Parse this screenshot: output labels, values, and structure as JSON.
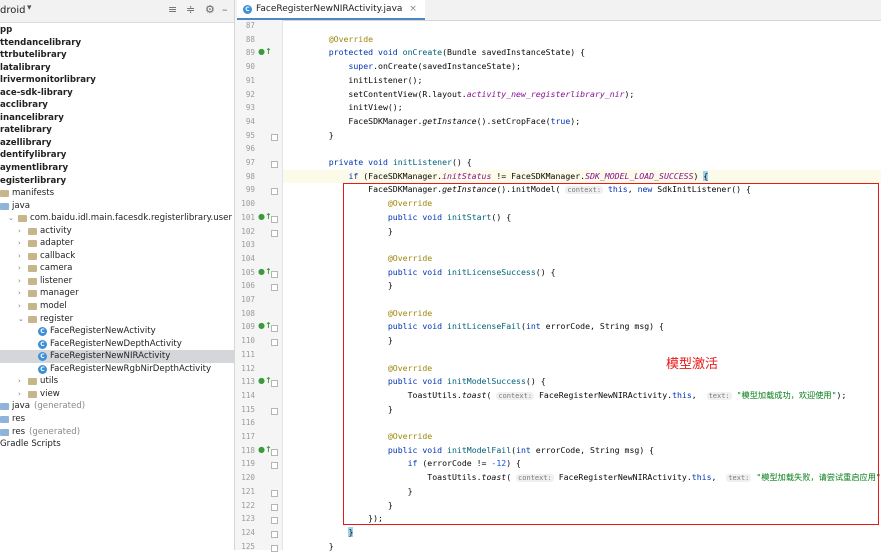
{
  "project_panel": {
    "title": "droid",
    "tree": [
      {
        "label": "pp",
        "bold": true,
        "indent": 0,
        "icon": "none"
      },
      {
        "label": "ttendancelibrary",
        "bold": true,
        "indent": 0,
        "icon": "none"
      },
      {
        "label": "ttrbutelibrary",
        "bold": true,
        "indent": 0,
        "icon": "none"
      },
      {
        "label": "latalibrary",
        "bold": true,
        "indent": 0,
        "icon": "none"
      },
      {
        "label": "lrivermonitorlibrary",
        "bold": true,
        "indent": 0,
        "icon": "none"
      },
      {
        "label": "ace-sdk-library",
        "bold": true,
        "indent": 0,
        "icon": "none"
      },
      {
        "label": "acclibrary",
        "bold": true,
        "indent": 0,
        "icon": "none"
      },
      {
        "label": "inancelibrary",
        "bold": true,
        "indent": 0,
        "icon": "none"
      },
      {
        "label": "ratelibrary",
        "bold": true,
        "indent": 0,
        "icon": "none"
      },
      {
        "label": "azellibrary",
        "bold": true,
        "indent": 0,
        "icon": "none"
      },
      {
        "label": "dentifylibrary",
        "bold": true,
        "indent": 0,
        "icon": "none"
      },
      {
        "label": "aymentlibrary",
        "bold": true,
        "indent": 0,
        "icon": "none"
      },
      {
        "label": "egisterlibrary",
        "bold": true,
        "indent": 0,
        "icon": "none"
      },
      {
        "label": "manifests",
        "bold": false,
        "indent": 0,
        "icon": "folder"
      },
      {
        "label": "java",
        "bold": false,
        "indent": 0,
        "icon": "folder"
      },
      {
        "label": "com.baidu.idl.main.facesdk.registerlibrary.user",
        "bold": false,
        "indent": 1,
        "icon": "folder",
        "arrow": "open"
      },
      {
        "label": "activity",
        "bold": false,
        "indent": 2,
        "icon": "folder",
        "arrow": "closed"
      },
      {
        "label": "adapter",
        "bold": false,
        "indent": 2,
        "icon": "folder",
        "arrow": "closed"
      },
      {
        "label": "callback",
        "bold": false,
        "indent": 2,
        "icon": "folder",
        "arrow": "closed"
      },
      {
        "label": "camera",
        "bold": false,
        "indent": 2,
        "icon": "folder",
        "arrow": "closed"
      },
      {
        "label": "listener",
        "bold": false,
        "indent": 2,
        "icon": "folder",
        "arrow": "closed"
      },
      {
        "label": "manager",
        "bold": false,
        "indent": 2,
        "icon": "folder",
        "arrow": "closed"
      },
      {
        "label": "model",
        "bold": false,
        "indent": 2,
        "icon": "folder",
        "arrow": "closed"
      },
      {
        "label": "register",
        "bold": false,
        "indent": 2,
        "icon": "folder",
        "arrow": "open"
      },
      {
        "label": "FaceRegisterNewActivity",
        "bold": false,
        "indent": 3,
        "icon": "class"
      },
      {
        "label": "FaceRegisterNewDepthActivity",
        "bold": false,
        "indent": 3,
        "icon": "class"
      },
      {
        "label": "FaceRegisterNewNIRActivity",
        "bold": false,
        "indent": 3,
        "icon": "class",
        "selected": true
      },
      {
        "label": "FaceRegisterNewRgbNirDepthActivity",
        "bold": false,
        "indent": 3,
        "icon": "class"
      },
      {
        "label": "utils",
        "bold": false,
        "indent": 2,
        "icon": "folder",
        "arrow": "closed"
      },
      {
        "label": "view",
        "bold": false,
        "indent": 2,
        "icon": "folder",
        "arrow": "closed"
      },
      {
        "label": "java",
        "bold": false,
        "indent": 0,
        "icon": "folder",
        "suffix": "(generated)"
      },
      {
        "label": "res",
        "bold": false,
        "indent": 0,
        "icon": "folder"
      },
      {
        "label": "res",
        "bold": false,
        "indent": 0,
        "icon": "folder",
        "suffix": "(generated)"
      },
      {
        "label": "Gradle Scripts",
        "bold": false,
        "indent": 0,
        "icon": "none"
      }
    ]
  },
  "editor": {
    "tab_label": "FaceRegisterNewNIRActivity.java",
    "annotation_note": "模型激活",
    "lines": [
      {
        "n": "87",
        "html": ""
      },
      {
        "n": "88",
        "html": "<span class='an'>    @Override</span>"
      },
      {
        "n": "89",
        "mark": "●↑",
        "html": "    <span class='kw'>protected void</span> <span class='fn'>onCreate</span>(Bundle savedInstanceState) {"
      },
      {
        "n": "90",
        "html": "        <span class='kw'>super</span>.onCreate(savedInstanceState);"
      },
      {
        "n": "91",
        "html": "        initListener();"
      },
      {
        "n": "92",
        "html": "        setContentView(R.layout.<span class='fd'>activity_new_registerlibrary_nir</span>);"
      },
      {
        "n": "93",
        "html": "        initView();"
      },
      {
        "n": "94",
        "html": "        FaceSDKManager.<span class='it'>getInstance</span>().setCropFace(<span class='kw'>true</span>);"
      },
      {
        "n": "95",
        "fold": true,
        "html": "    }"
      },
      {
        "n": "96",
        "html": ""
      },
      {
        "n": "97",
        "fold": true,
        "html": "    <span class='kw'>private void</span> <span class='fn'>initListener</span>() {"
      },
      {
        "n": "98",
        "hl": true,
        "html": "        <span class='kw'>if</span> (FaceSDKManager.<span class='fd'>initStatus</span> != FaceSDKManager.<span class='fd'>SDK_MODEL_LOAD_SUCCESS</span>) <span class='brm'>{</span>"
      },
      {
        "n": "99",
        "fold": true,
        "html": "            FaceSDKManager.<span class='it'>getInstance</span>().initModel( <span class='hint'>context:</span> <span class='kw'>this</span>, <span class='kw'>new</span> SdkInitListener() {"
      },
      {
        "n": "100",
        "html": "                <span class='an'>@Override</span>"
      },
      {
        "n": "101",
        "mark": "●↑",
        "fold": true,
        "html": "                <span class='kw'>public void</span> <span class='fn'>initStart</span>() {"
      },
      {
        "n": "102",
        "fold": true,
        "html": "                }"
      },
      {
        "n": "103",
        "html": ""
      },
      {
        "n": "104",
        "html": "                <span class='an'>@Override</span>"
      },
      {
        "n": "105",
        "mark": "●↑",
        "fold": true,
        "html": "                <span class='kw'>public void</span> <span class='fn'>initLicenseSuccess</span>() {"
      },
      {
        "n": "106",
        "fold": true,
        "html": "                }"
      },
      {
        "n": "107",
        "html": ""
      },
      {
        "n": "108",
        "html": "                <span class='an'>@Override</span>"
      },
      {
        "n": "109",
        "mark": "●↑",
        "fold": true,
        "html": "                <span class='kw'>public void</span> <span class='fn'>initLicenseFail</span>(<span class='kw'>int</span> errorCode, String msg) {"
      },
      {
        "n": "110",
        "fold": true,
        "html": "                }"
      },
      {
        "n": "111",
        "html": ""
      },
      {
        "n": "112",
        "html": "                <span class='an'>@Override</span>"
      },
      {
        "n": "113",
        "mark": "●↑",
        "fold": true,
        "html": "                <span class='kw'>public void</span> <span class='fn'>initModelSuccess</span>() {"
      },
      {
        "n": "114",
        "html": "                    ToastUtils.<span class='it'>toast</span>( <span class='hint'>context:</span> FaceRegisterNewNIRActivity.<span class='kw'>this</span>,  <span class='hint'>text:</span> <span class='st'>\"模型加载成功，欢迎使用\"</span>);"
      },
      {
        "n": "115",
        "fold": true,
        "html": "                }"
      },
      {
        "n": "116",
        "html": ""
      },
      {
        "n": "117",
        "html": "                <span class='an'>@Override</span>"
      },
      {
        "n": "118",
        "mark": "●↑",
        "fold": true,
        "html": "                <span class='kw'>public void</span> <span class='fn'>initModelFail</span>(<span class='kw'>int</span> errorCode, String msg) {"
      },
      {
        "n": "119",
        "fold": true,
        "html": "                    <span class='kw'>if</span> (errorCode != <span class='num'>-12</span>) {"
      },
      {
        "n": "120",
        "html": "                        ToastUtils.<span class='it'>toast</span>( <span class='hint'>context:</span> FaceRegisterNewNIRActivity.<span class='kw'>this</span>,  <span class='hint'>text:</span> <span class='st'>\"模型加载失败，请尝试重启应用\"</span>);"
      },
      {
        "n": "121",
        "fold": true,
        "html": "                    }"
      },
      {
        "n": "122",
        "fold": true,
        "html": "                }"
      },
      {
        "n": "123",
        "fold": true,
        "html": "            });"
      },
      {
        "n": "124",
        "fold": true,
        "html": "        <span class='brm'>}</span>"
      },
      {
        "n": "125",
        "fold": true,
        "html": "    }"
      }
    ]
  }
}
